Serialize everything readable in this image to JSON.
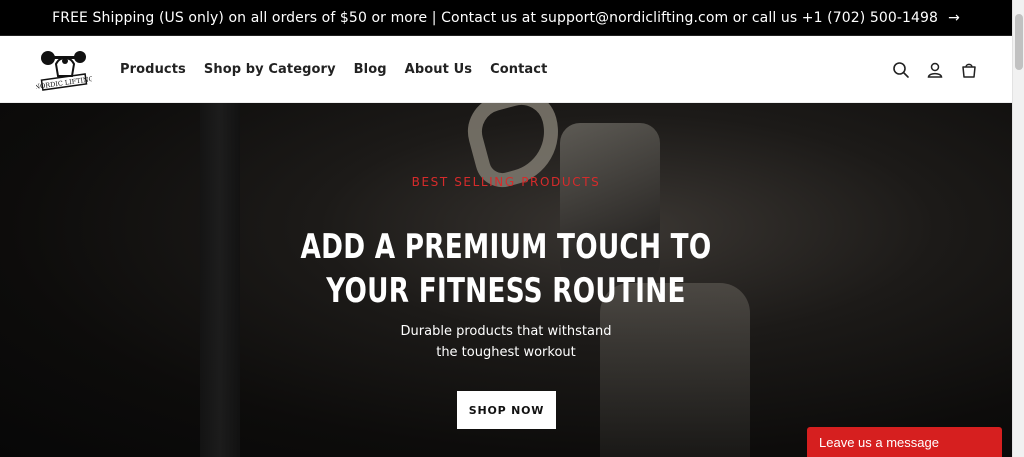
{
  "announcement": {
    "text": "FREE Shipping (US only) on all orders of $50 or more | Contact us at support@nordiclifting.com or call us +1 (702) 500-1498",
    "arrow": "→"
  },
  "header": {
    "logo_text": "NORDIC LIFTING",
    "nav": [
      "Products",
      "Shop by Category",
      "Blog",
      "About Us",
      "Contact"
    ],
    "icons": [
      "search-icon",
      "account-icon",
      "cart-icon"
    ]
  },
  "hero": {
    "eyebrow": "BEST SELLING PRODUCTS",
    "headline_line1": "ADD A PREMIUM TOUCH TO",
    "headline_line2": "YOUR FITNESS ROUTINE",
    "sub_line1": "Durable products that withstand",
    "sub_line2": "the toughest workout",
    "cta_label": "SHOP NOW"
  },
  "chat": {
    "label": "Leave us a message"
  },
  "colors": {
    "accent_red": "#d62b2b",
    "chat_red": "#d61f1f",
    "announcement_bg": "#000000"
  }
}
